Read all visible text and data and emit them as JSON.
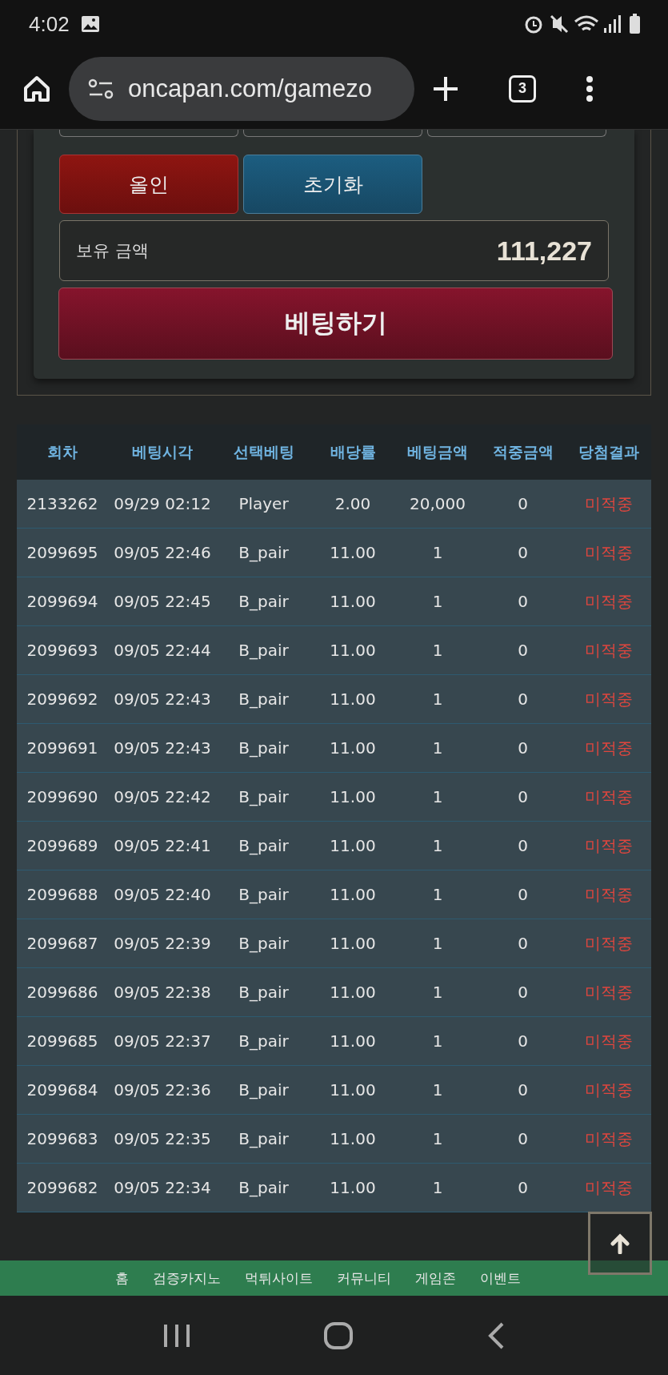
{
  "status_bar": {
    "time": "4:02"
  },
  "browser": {
    "url": "oncapan.com/gamezo",
    "tab_count": "3"
  },
  "bet_panel": {
    "buttons": [
      {
        "label": "올인",
        "kind": "allin"
      },
      {
        "label": "초기화",
        "kind": "reset"
      }
    ],
    "balance": {
      "label": "보유 금액",
      "value": "111,227"
    },
    "submit": "베팅하기"
  },
  "table": {
    "columns": [
      "회차",
      "베팅시각",
      "선택베팅",
      "배당률",
      "베팅금액",
      "적중금액",
      "당첨결과"
    ],
    "rows": [
      [
        "2133262",
        "09/29 02:12",
        "Player",
        "2.00",
        "20,000",
        "0",
        "미적중"
      ],
      [
        "2099695",
        "09/05 22:46",
        "B_pair",
        "11.00",
        "1",
        "0",
        "미적중"
      ],
      [
        "2099694",
        "09/05 22:45",
        "B_pair",
        "11.00",
        "1",
        "0",
        "미적중"
      ],
      [
        "2099693",
        "09/05 22:44",
        "B_pair",
        "11.00",
        "1",
        "0",
        "미적중"
      ],
      [
        "2099692",
        "09/05 22:43",
        "B_pair",
        "11.00",
        "1",
        "0",
        "미적중"
      ],
      [
        "2099691",
        "09/05 22:43",
        "B_pair",
        "11.00",
        "1",
        "0",
        "미적중"
      ],
      [
        "2099690",
        "09/05 22:42",
        "B_pair",
        "11.00",
        "1",
        "0",
        "미적중"
      ],
      [
        "2099689",
        "09/05 22:41",
        "B_pair",
        "11.00",
        "1",
        "0",
        "미적중"
      ],
      [
        "2099688",
        "09/05 22:40",
        "B_pair",
        "11.00",
        "1",
        "0",
        "미적중"
      ],
      [
        "2099687",
        "09/05 22:39",
        "B_pair",
        "11.00",
        "1",
        "0",
        "미적중"
      ],
      [
        "2099686",
        "09/05 22:38",
        "B_pair",
        "11.00",
        "1",
        "0",
        "미적중"
      ],
      [
        "2099685",
        "09/05 22:37",
        "B_pair",
        "11.00",
        "1",
        "0",
        "미적중"
      ],
      [
        "2099684",
        "09/05 22:36",
        "B_pair",
        "11.00",
        "1",
        "0",
        "미적중"
      ],
      [
        "2099683",
        "09/05 22:35",
        "B_pair",
        "11.00",
        "1",
        "0",
        "미적중"
      ],
      [
        "2099682",
        "09/05 22:34",
        "B_pair",
        "11.00",
        "1",
        "0",
        "미적중"
      ]
    ]
  },
  "footer_nav": [
    "홈",
    "검증카지노",
    "먹튀사이트",
    "커뮤니티",
    "게임존",
    "이벤트"
  ]
}
